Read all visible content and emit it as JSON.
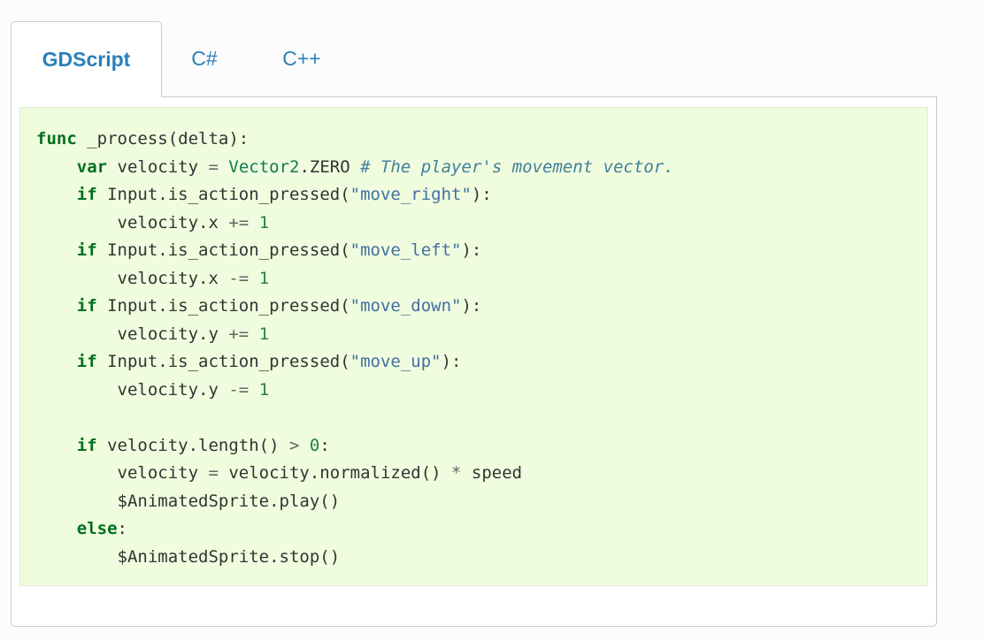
{
  "tabs": [
    {
      "label": "GDScript",
      "active": true
    },
    {
      "label": "C#",
      "active": false
    },
    {
      "label": "C++",
      "active": false
    }
  ],
  "colors": {
    "tab_text": "#2980b9",
    "code_background": "#f0fcde",
    "keyword": "#007020",
    "string": "#4070a0",
    "number": "#208050",
    "comment": "#40809a"
  },
  "code": {
    "language": "GDScript",
    "lines": [
      [
        {
          "t": "func",
          "k": "kw"
        },
        {
          "t": " _process(delta):",
          "k": ""
        }
      ],
      [
        {
          "t": "    ",
          "k": ""
        },
        {
          "t": "var",
          "k": "kw"
        },
        {
          "t": " velocity ",
          "k": ""
        },
        {
          "t": "=",
          "k": "op"
        },
        {
          "t": " ",
          "k": ""
        },
        {
          "t": "Vector2",
          "k": "cls"
        },
        {
          "t": ".ZERO ",
          "k": ""
        },
        {
          "t": "# The player's movement vector.",
          "k": "com"
        }
      ],
      [
        {
          "t": "    ",
          "k": ""
        },
        {
          "t": "if",
          "k": "kw"
        },
        {
          "t": " Input.is_action_pressed(",
          "k": ""
        },
        {
          "t": "\"move_right\"",
          "k": "str"
        },
        {
          "t": "):",
          "k": ""
        }
      ],
      [
        {
          "t": "        velocity.x ",
          "k": ""
        },
        {
          "t": "+=",
          "k": "op"
        },
        {
          "t": " ",
          "k": ""
        },
        {
          "t": "1",
          "k": "num"
        }
      ],
      [
        {
          "t": "    ",
          "k": ""
        },
        {
          "t": "if",
          "k": "kw"
        },
        {
          "t": " Input.is_action_pressed(",
          "k": ""
        },
        {
          "t": "\"move_left\"",
          "k": "str"
        },
        {
          "t": "):",
          "k": ""
        }
      ],
      [
        {
          "t": "        velocity.x ",
          "k": ""
        },
        {
          "t": "-=",
          "k": "op"
        },
        {
          "t": " ",
          "k": ""
        },
        {
          "t": "1",
          "k": "num"
        }
      ],
      [
        {
          "t": "    ",
          "k": ""
        },
        {
          "t": "if",
          "k": "kw"
        },
        {
          "t": " Input.is_action_pressed(",
          "k": ""
        },
        {
          "t": "\"move_down\"",
          "k": "str"
        },
        {
          "t": "):",
          "k": ""
        }
      ],
      [
        {
          "t": "        velocity.y ",
          "k": ""
        },
        {
          "t": "+=",
          "k": "op"
        },
        {
          "t": " ",
          "k": ""
        },
        {
          "t": "1",
          "k": "num"
        }
      ],
      [
        {
          "t": "    ",
          "k": ""
        },
        {
          "t": "if",
          "k": "kw"
        },
        {
          "t": " Input.is_action_pressed(",
          "k": ""
        },
        {
          "t": "\"move_up\"",
          "k": "str"
        },
        {
          "t": "):",
          "k": ""
        }
      ],
      [
        {
          "t": "        velocity.y ",
          "k": ""
        },
        {
          "t": "-=",
          "k": "op"
        },
        {
          "t": " ",
          "k": ""
        },
        {
          "t": "1",
          "k": "num"
        }
      ],
      [
        {
          "t": "",
          "k": ""
        }
      ],
      [
        {
          "t": "    ",
          "k": ""
        },
        {
          "t": "if",
          "k": "kw"
        },
        {
          "t": " velocity.length() ",
          "k": ""
        },
        {
          "t": ">",
          "k": "op"
        },
        {
          "t": " ",
          "k": ""
        },
        {
          "t": "0",
          "k": "num"
        },
        {
          "t": ":",
          "k": ""
        }
      ],
      [
        {
          "t": "        velocity ",
          "k": ""
        },
        {
          "t": "=",
          "k": "op"
        },
        {
          "t": " velocity.normalized() ",
          "k": ""
        },
        {
          "t": "*",
          "k": "op"
        },
        {
          "t": " speed",
          "k": ""
        }
      ],
      [
        {
          "t": "        $AnimatedSprite.play()",
          "k": ""
        }
      ],
      [
        {
          "t": "    ",
          "k": ""
        },
        {
          "t": "else",
          "k": "kw"
        },
        {
          "t": ":",
          "k": ""
        }
      ],
      [
        {
          "t": "        $AnimatedSprite.stop()",
          "k": ""
        }
      ]
    ]
  }
}
